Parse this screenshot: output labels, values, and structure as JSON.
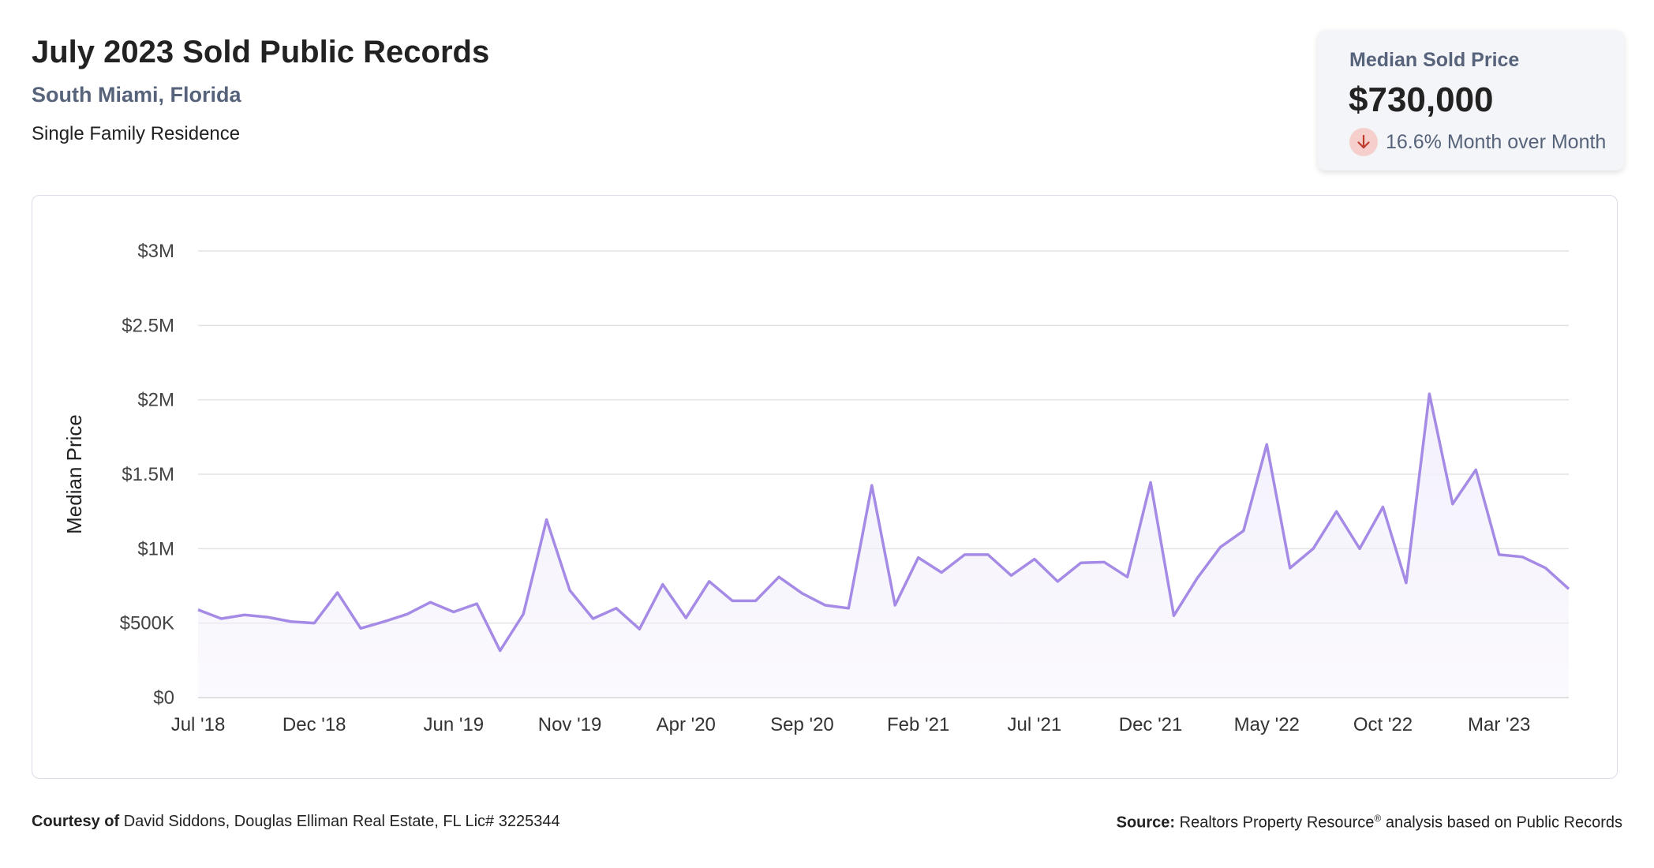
{
  "header": {
    "title": "July 2023 Sold Public Records",
    "location": "South Miami, Florida",
    "property_type": "Single Family Residence"
  },
  "stat_card": {
    "label": "Median Sold Price",
    "value": "$730,000",
    "change": "16.6% Month over Month",
    "direction": "down",
    "icon": "arrow-down-icon",
    "icon_color": "#c0392b",
    "icon_bg": "#f6cfcc"
  },
  "colors": {
    "line": "#a58be6",
    "fill": "#f3f0fb",
    "grid": "#e2e2e2",
    "axis": "#cfcfcf"
  },
  "chart_data": {
    "type": "area",
    "ylabel": "Median Price",
    "ylim": [
      0,
      3000000
    ],
    "yticks": [
      {
        "value": 0,
        "label": "$0"
      },
      {
        "value": 500000,
        "label": "$500K"
      },
      {
        "value": 1000000,
        "label": "$1M"
      },
      {
        "value": 1500000,
        "label": "$1.5M"
      },
      {
        "value": 2000000,
        "label": "$2M"
      },
      {
        "value": 2500000,
        "label": "$2.5M"
      },
      {
        "value": 3000000,
        "label": "$3M"
      }
    ],
    "xticks": [
      {
        "index": 0,
        "label": "Jul '18"
      },
      {
        "index": 5,
        "label": "Dec '18"
      },
      {
        "index": 11,
        "label": "Jun '19"
      },
      {
        "index": 16,
        "label": "Nov '19"
      },
      {
        "index": 21,
        "label": "Apr '20"
      },
      {
        "index": 26,
        "label": "Sep '20"
      },
      {
        "index": 31,
        "label": "Feb '21"
      },
      {
        "index": 36,
        "label": "Jul '21"
      },
      {
        "index": 41,
        "label": "Dec '21"
      },
      {
        "index": 46,
        "label": "May '22"
      },
      {
        "index": 51,
        "label": "Oct '22"
      },
      {
        "index": 56,
        "label": "Mar '23"
      }
    ],
    "series": [
      {
        "values": [
          590000,
          530000,
          555000,
          540000,
          510000,
          500000,
          705000,
          465000,
          510000,
          560000,
          640000,
          575000,
          630000,
          315000,
          560000,
          1195000,
          720000,
          530000,
          600000,
          460000,
          760000,
          535000,
          780000,
          650000,
          650000,
          810000,
          700000,
          620000,
          600000,
          1425000,
          620000,
          940000,
          840000,
          960000,
          960000,
          820000,
          930000,
          780000,
          905000,
          910000,
          810000,
          1445000,
          550000,
          800000,
          1010000,
          1120000,
          1700000,
          870000,
          1000000,
          1250000,
          1000000,
          1280000,
          770000,
          2040000,
          1300000,
          1530000,
          960000,
          945000,
          870000,
          730000
        ]
      }
    ]
  },
  "footer": {
    "courtesy_label": "Courtesy of",
    "courtesy_text": "David Siddons, Douglas Elliman Real Estate, FL Lic# 3225344",
    "source_label": "Source:",
    "source_text_1": "Realtors Property Resource",
    "source_reg": "®",
    "source_text_2": "analysis based on Public Records"
  }
}
